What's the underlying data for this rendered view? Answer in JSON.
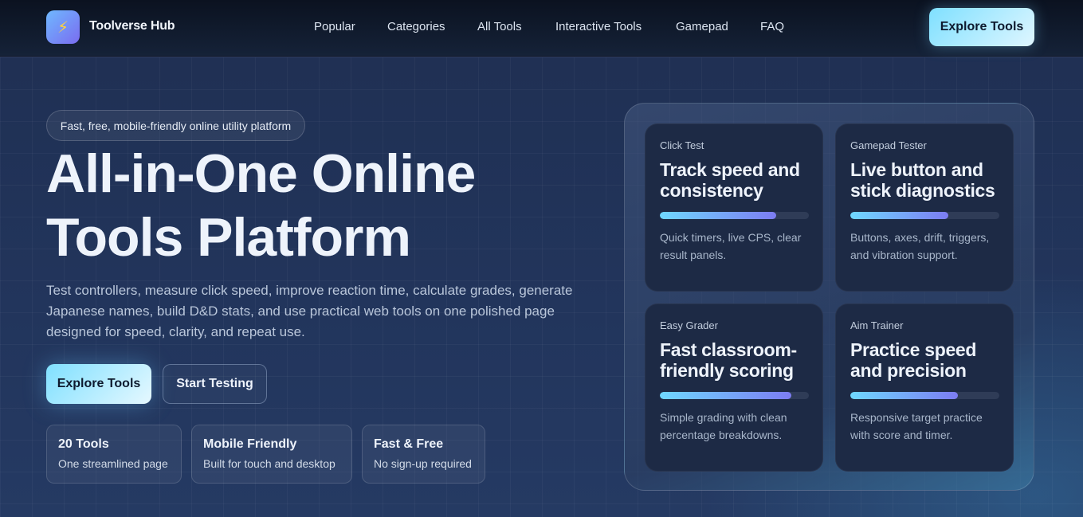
{
  "header": {
    "logo_icon": "lightning-icon",
    "brand": "Toolverse Hub",
    "nav": [
      "Popular",
      "Categories",
      "All Tools",
      "Interactive Tools",
      "Gamepad",
      "FAQ"
    ],
    "cta": "Explore Tools"
  },
  "hero": {
    "pill": "Fast, free, mobile-friendly online utility platform",
    "title_line1": "All-in-One Online",
    "title_line2": "Tools Platform",
    "description": "Test controllers, measure click speed, improve reaction time, calculate grades, generate Japanese names, build D&D stats, and use practical web tools on one polished page designed for speed, clarity, and repeat use.",
    "primary_button": "Explore Tools",
    "secondary_button": "Start Testing",
    "stats": [
      {
        "title": "20 Tools",
        "subtitle": "One streamlined page"
      },
      {
        "title": "Mobile Friendly",
        "subtitle": "Built for touch and desktop"
      },
      {
        "title": "Fast & Free",
        "subtitle": "No sign-up required"
      }
    ]
  },
  "cards": [
    {
      "label": "Click Test",
      "title": "Track speed and consistency",
      "progress": 0.78,
      "desc": "Quick timers, live CPS, clear result panels."
    },
    {
      "label": "Gamepad Tester",
      "title": "Live button and stick diagnostics",
      "progress": 0.66,
      "desc": "Buttons, axes, drift, triggers, and vibration support."
    },
    {
      "label": "Easy Grader",
      "title": "Fast classroom-friendly scoring",
      "progress": 0.88,
      "desc": "Simple grading with clean percentage breakdowns."
    },
    {
      "label": "Aim Trainer",
      "title": "Practice speed and precision",
      "progress": 0.72,
      "desc": "Responsive target practice with score and timer."
    }
  ],
  "colors": {
    "accent": "#7fe0ff",
    "bar_start": "#6fd8ff",
    "bar_end": "#7c7cf2",
    "background": "#1e2d4d"
  }
}
